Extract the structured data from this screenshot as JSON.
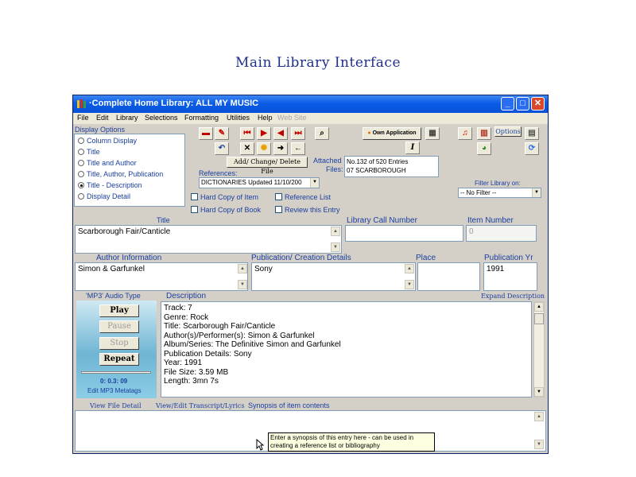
{
  "page_heading": "Main Library Interface",
  "window": {
    "title": "·Complete Home Library: ALL MY MUSIC",
    "min_label": "_",
    "max_label": "□",
    "close_label": "✕"
  },
  "menu": [
    "File",
    "Edit",
    "Library",
    "Selections",
    "Formatting",
    "Utilities",
    "Help",
    "Web Site"
  ],
  "display_options": {
    "label": "Display Options",
    "items": [
      "Column Display",
      "Title",
      "Title and  Author",
      "Title, Author, Publication",
      "Title - Description",
      "Display Detail"
    ],
    "selected": "Title - Description"
  },
  "toolbar": {
    "add_change_delete": "Add/ Change/ Delete File",
    "own_application": "Own Application",
    "options": "Options",
    "italic_label": "I",
    "first": "⏮",
    "next": "▶",
    "prev": "◀",
    "last": "⏭",
    "delete": "✕",
    "forward": "➜",
    "back": "←",
    "undo": "↶"
  },
  "references": {
    "label": "References:",
    "selected": "DICTIONARIES Updated 11/10/200",
    "arrow": "▼"
  },
  "attached_files": {
    "label_line1": "Attached",
    "label_line2": "Files:",
    "line1": "No.132  of 520 Entries",
    "line2": "07 SCARBOROUGH"
  },
  "filter": {
    "label": "Filter Library on:",
    "selected": "-- No Filter --",
    "arrow": "▼"
  },
  "checkboxes": [
    "Hard Copy of Item",
    "Reference List",
    "Hard Copy of Book",
    "Review this Entry"
  ],
  "fields": {
    "title_label": "Title",
    "title_value": "Scarborough Fair/Canticle",
    "call_number_label": "Library Call Number",
    "call_number_value": "",
    "item_number_label": "Item Number",
    "item_number_value": "0",
    "author_label": "Author Information",
    "author_value": "Simon & Garfunkel",
    "publication_label": "Publication/ Creation Details",
    "publication_value": "Sony",
    "place_label": "Place",
    "place_value": "",
    "pub_year_label": "Publication Yr",
    "pub_year_value": "1991"
  },
  "audio": {
    "type_label": "'MP3' Audio Type",
    "description_label": "Description",
    "expand_label": "Expand Description",
    "play": "Play",
    "pause": "Pause",
    "stop": "Stop",
    "repeat": "Repeat",
    "time": "0: 0.3: 09",
    "edit_tags": "Edit MP3 Metatags",
    "progress_fraction": 0.0
  },
  "description_lines": [
    "Track: 7",
    "Genre: Rock",
    "Title: Scarborough Fair/Canticle",
    "Author(s)/Performer(s): Simon & Garfunkel",
    "Album/Series: The Definitive Simon and Garfunkel",
    "Publication Details: Sony",
    "Year: 1991",
    "File Size: 3.59 MB",
    "Length: 3mn 7s"
  ],
  "bottom_tabs": [
    "View File Detail",
    "View/Edit Transcript/Lyrics",
    "Synopsis of item contents"
  ],
  "tooltip": {
    "line1": "Enter a synopsis of this entry here - can be used in",
    "line2": "creating a reference list or bibliography"
  },
  "scroll": {
    "up": "▲",
    "down": "▼"
  }
}
